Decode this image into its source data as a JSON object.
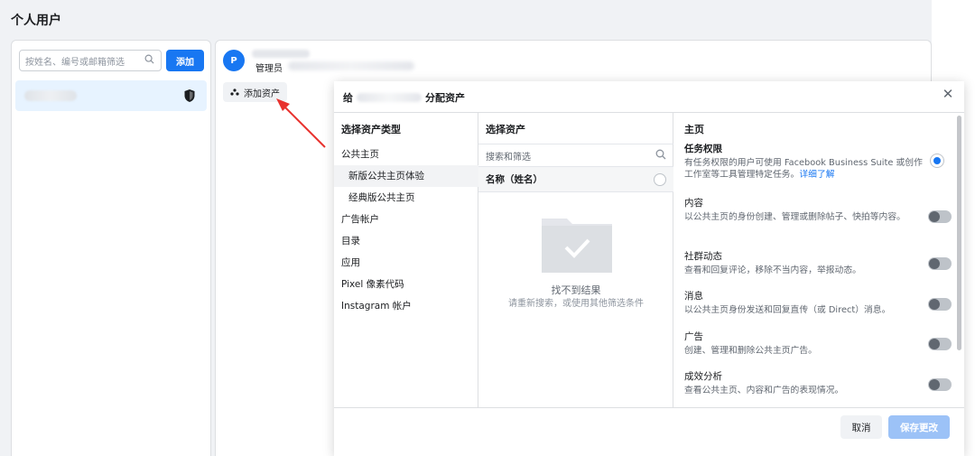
{
  "page": {
    "title": "个人用户"
  },
  "user_panel": {
    "search_placeholder": "按姓名、编号或邮箱筛选",
    "add_label": "添加"
  },
  "main": {
    "avatar_letter": "P",
    "role": "管理员",
    "add_asset_label": "添加资产"
  },
  "modal": {
    "title_prefix": "给",
    "title_suffix": "分配资产",
    "col1_head": "选择资产类型",
    "asset_types": [
      {
        "label": "公共主页"
      },
      {
        "label": "新版公共主页体验"
      },
      {
        "label": "经典版公共主页"
      },
      {
        "label": "广告帐户"
      },
      {
        "label": "目录"
      },
      {
        "label": "应用"
      },
      {
        "label": "Pixel 像素代码"
      },
      {
        "label": "Instagram 帐户"
      }
    ],
    "col2_head": "选择资产",
    "search_placeholder": "搜索和筛选",
    "name_header": "名称（姓名）",
    "empty_title": "找不到结果",
    "empty_sub": "请重新搜索，或使用其他筛选条件",
    "col3_head": "主页",
    "perms": [
      {
        "title": "任务权限",
        "desc": "有任务权限的用户可使用 Facebook Business Suite 或创作工作室等工具管理特定任务。",
        "link": "详细了解"
      },
      {
        "title": "内容",
        "desc": "以公共主页的身份创建、管理或删除帖子、快拍等内容。"
      },
      {
        "title": "社群动态",
        "desc": "查看和回复评论，移除不当内容，举报动态。"
      },
      {
        "title": "消息",
        "desc": "以公共主页身份发送和回复直传（或 Direct）消息。"
      },
      {
        "title": "广告",
        "desc": "创建、管理和删除公共主页广告。"
      },
      {
        "title": "成效分析",
        "desc": "查看公共主页、内容和广告的表现情况。"
      }
    ],
    "cancel_label": "取消",
    "save_label": "保存更改"
  },
  "colors": {
    "accent": "#1877f2",
    "arrow": "#e8322e"
  },
  "icons": [
    "search-icon",
    "shield-icon",
    "people-icon",
    "close-icon",
    "empty-folder-icon"
  ]
}
